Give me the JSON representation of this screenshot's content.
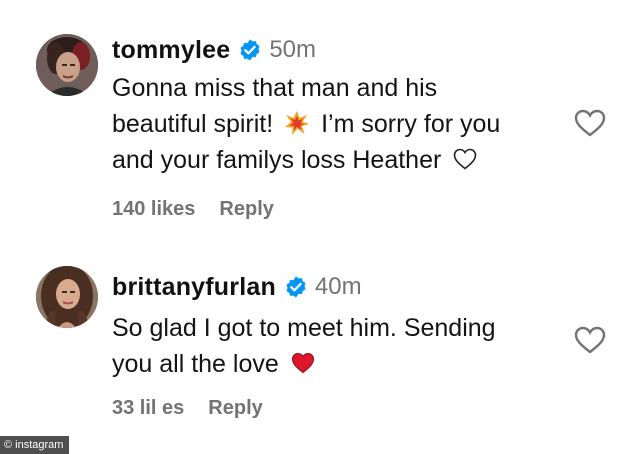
{
  "comments": [
    {
      "username": "tommylee",
      "time": "50m",
      "lines": [
        "Gonna miss that man and his",
        "beautiful spirit!",
        "I’m sorry for you",
        "and your familys loss Heather"
      ],
      "likes": "140 likes",
      "reply": "Reply",
      "icons": {
        "avatar": "avatar-photo",
        "verified": "verified-badge-icon",
        "emoji_1": "collision-emoji",
        "emoji_2": "white-heart-emoji",
        "like": "heart-outline-icon"
      }
    },
    {
      "username": "brittanyfurlan",
      "time": "40m",
      "lines": [
        "So glad I got to meet him. Sending",
        "you all the love"
      ],
      "likes": "33 lil es",
      "reply": "Reply",
      "icons": {
        "avatar": "avatar-photo",
        "verified": "verified-badge-icon",
        "emoji_1": "red-heart-emoji",
        "like": "heart-outline-icon"
      }
    }
  ],
  "credit": "© instagram",
  "colors": {
    "verified_blue": "#0095f6",
    "secondary_text": "#737373",
    "heart_red": "#e0162b"
  }
}
